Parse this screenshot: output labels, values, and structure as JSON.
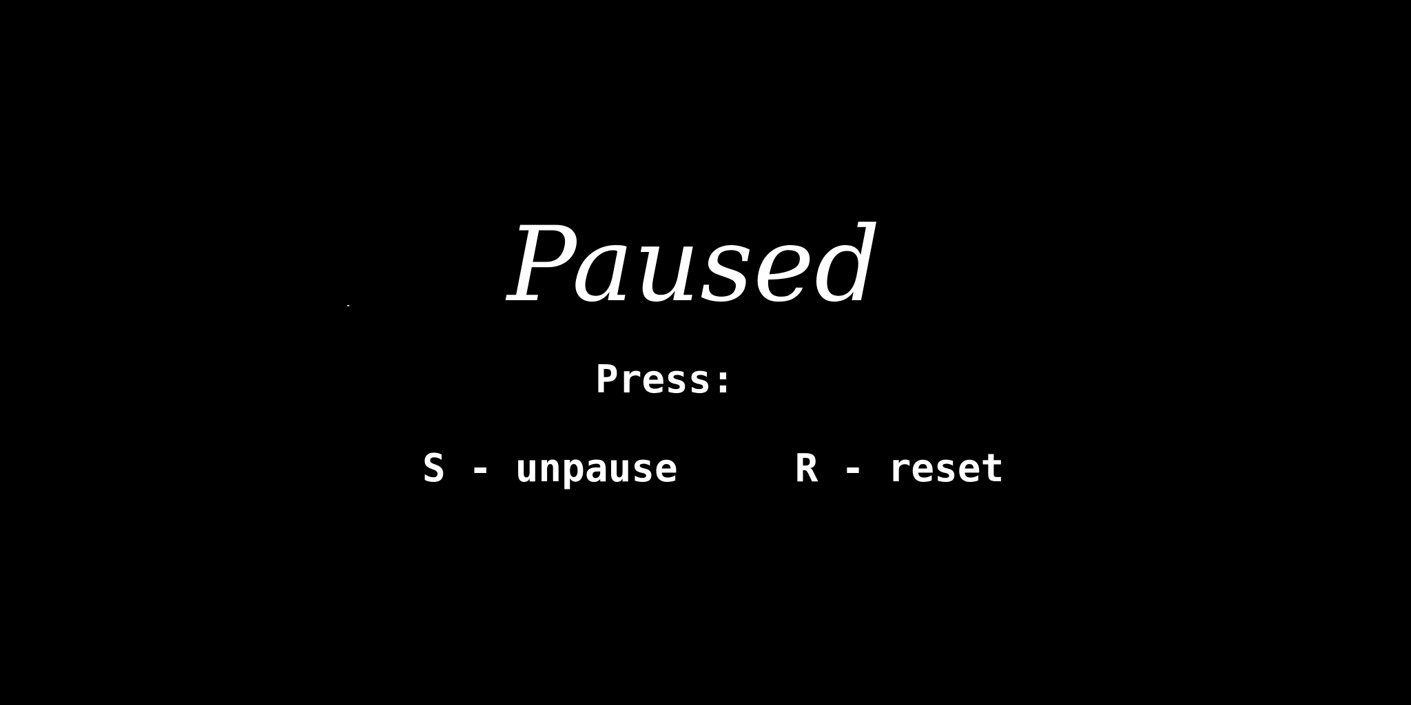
{
  "pause_screen": {
    "title": "Paused",
    "prompt": "Press:",
    "controls": [
      {
        "label": "S - unpause"
      },
      {
        "label": "R - reset"
      }
    ]
  },
  "colors": {
    "background": "#000000",
    "text": "#ffffff"
  }
}
